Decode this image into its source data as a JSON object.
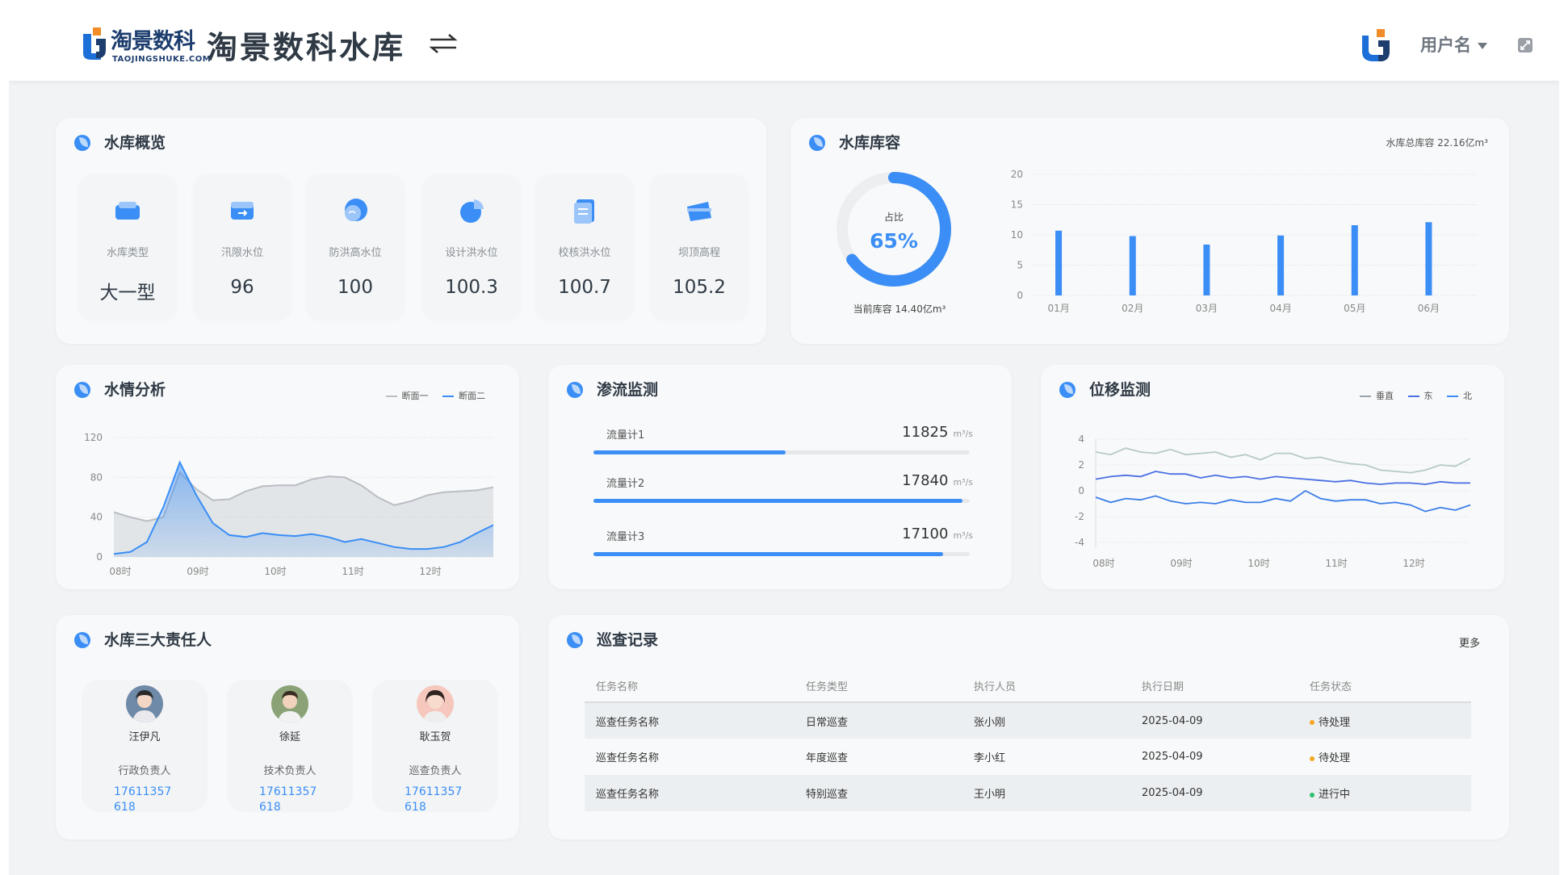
{
  "header": {
    "logo_text": "淘景数科",
    "logo_sub": "TAOJINGSHUKE.COM",
    "title": "淘景数科水库",
    "user_name": "用户名"
  },
  "overview": {
    "title": "水库概览",
    "items": [
      {
        "label": "水库类型",
        "value": "大一型",
        "icon": "reservoir-type-icon"
      },
      {
        "label": "汛限水位",
        "value": "96",
        "icon": "flood-limit-icon"
      },
      {
        "label": "防洪高水位",
        "value": "100",
        "icon": "flood-high-icon"
      },
      {
        "label": "设计洪水位",
        "value": "100.3",
        "icon": "design-flood-icon"
      },
      {
        "label": "校核洪水位",
        "value": "100.7",
        "icon": "check-flood-icon"
      },
      {
        "label": "坝顶高程",
        "value": "105.2",
        "icon": "dam-crest-icon"
      }
    ]
  },
  "capacity": {
    "title": "水库库容",
    "total_label": "水库总库容 22.16亿m³",
    "ratio_label": "占比",
    "ratio_value": "65%",
    "ratio": 0.65,
    "current_label": "当前库容 14.40亿m³"
  },
  "water": {
    "title": "水情分析",
    "legend": [
      "断面一",
      "断面二"
    ]
  },
  "seepage": {
    "title": "渗流监测",
    "unit": "m³/s",
    "items": [
      {
        "name": "流量计1",
        "value": "11825",
        "fill": 0.51
      },
      {
        "name": "流量计2",
        "value": "17840",
        "fill": 0.98
      },
      {
        "name": "流量计3",
        "value": "17100",
        "fill": 0.93
      }
    ]
  },
  "displacement": {
    "title": "位移监测",
    "legend": [
      "垂直",
      "东",
      "北"
    ]
  },
  "persons": {
    "title": "水库三大责任人",
    "items": [
      {
        "name": "汪伊凡",
        "role": "行政负责人",
        "phone": "17611357618"
      },
      {
        "name": "徐延",
        "role": "技术负责人",
        "phone": "17611357618"
      },
      {
        "name": "耿玉贺",
        "role": "巡查负责人",
        "phone": "17611357618"
      }
    ]
  },
  "patrol": {
    "title": "巡查记录",
    "more": "更多",
    "columns": [
      "任务名称",
      "任务类型",
      "执行人员",
      "执行日期",
      "任务状态"
    ],
    "rows": [
      {
        "name": "巡查任务名称",
        "type": "日常巡查",
        "person": "张小刚",
        "date": "2025-04-09",
        "status": "待处理",
        "status_color": "#f5a623"
      },
      {
        "name": "巡查任务名称",
        "type": "年度巡查",
        "person": "李小红",
        "date": "2025-04-09",
        "status": "待处理",
        "status_color": "#f5a623"
      },
      {
        "name": "巡查任务名称",
        "type": "特别巡查",
        "person": "王小明",
        "date": "2025-04-09",
        "status": "进行中",
        "status_color": "#2fbf71"
      }
    ]
  },
  "colors": {
    "accent": "#3a8ef5",
    "gray_series": "#b9bec3"
  },
  "chart_data": [
    {
      "id": "capacity-bars",
      "type": "bar",
      "categories": [
        "01月",
        "02月",
        "03月",
        "04月",
        "05月",
        "06月"
      ],
      "values": [
        10.7,
        9.8,
        8.4,
        9.9,
        11.6,
        12.1
      ],
      "ylim": [
        0,
        20
      ],
      "yticks": [
        0,
        5,
        10,
        15,
        20
      ],
      "grid": true
    },
    {
      "id": "water-analysis",
      "type": "area",
      "x": [
        "08时",
        "09时",
        "10时",
        "11时",
        "12时"
      ],
      "ylim": [
        0,
        120
      ],
      "yticks": [
        0,
        40,
        80,
        120
      ],
      "grid": true,
      "legend": "top-right",
      "series": [
        {
          "name": "断面一",
          "values": [
            45,
            40,
            36,
            40,
            85,
            68,
            57,
            58,
            66,
            71,
            72,
            72,
            78,
            81,
            80,
            72,
            60,
            52,
            56,
            62,
            65,
            66,
            67,
            70
          ]
        },
        {
          "name": "断面二",
          "values": [
            3,
            5,
            15,
            50,
            95,
            62,
            34,
            22,
            20,
            24,
            22,
            21,
            23,
            20,
            15,
            18,
            14,
            10,
            8,
            8,
            10,
            15,
            24,
            32
          ]
        }
      ]
    },
    {
      "id": "displacement",
      "type": "line",
      "x": [
        "08时",
        "09时",
        "10时",
        "11时",
        "12时"
      ],
      "ylim": [
        -4,
        4
      ],
      "yticks": [
        -4,
        -2,
        0,
        2,
        4
      ],
      "grid": true,
      "legend": "top-right",
      "series": [
        {
          "name": "垂直",
          "values": [
            3.0,
            2.8,
            3.3,
            3.0,
            2.9,
            3.2,
            2.8,
            2.9,
            3.0,
            2.6,
            2.8,
            2.4,
            2.9,
            2.9,
            2.5,
            2.6,
            2.3,
            2.1,
            2.0,
            1.6,
            1.5,
            1.4,
            1.6,
            2.0,
            1.9,
            2.5
          ]
        },
        {
          "name": "东",
          "values": [
            0.9,
            1.1,
            1.2,
            1.1,
            1.5,
            1.3,
            1.3,
            1.0,
            1.2,
            1.0,
            1.1,
            0.9,
            1.1,
            1.0,
            0.9,
            0.8,
            0.7,
            0.8,
            0.6,
            0.5,
            0.6,
            0.6,
            0.5,
            0.7,
            0.6,
            0.6
          ]
        },
        {
          "name": "北",
          "values": [
            -0.5,
            -0.9,
            -0.6,
            -0.7,
            -0.4,
            -0.8,
            -1.0,
            -0.9,
            -1.0,
            -0.7,
            -0.9,
            -0.9,
            -0.6,
            -0.8,
            0.0,
            -0.6,
            -0.8,
            -0.7,
            -0.7,
            -1.0,
            -0.9,
            -1.1,
            -1.6,
            -1.3,
            -1.5,
            -1.1
          ]
        }
      ]
    }
  ]
}
